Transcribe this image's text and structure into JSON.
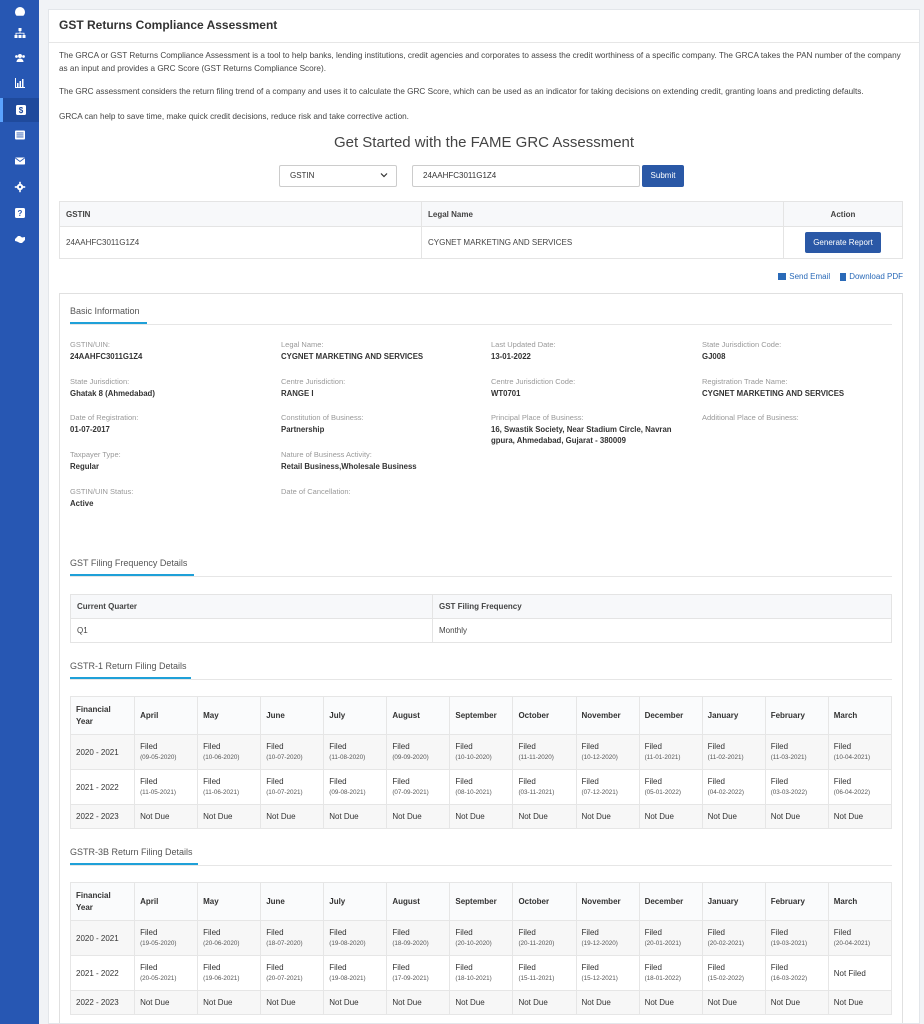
{
  "sidebar": {
    "items": [
      "dashboard-icon",
      "sitemap-icon",
      "users-icon",
      "chart-icon",
      "dollar-icon",
      "list-icon",
      "mail-icon",
      "gear-icon",
      "help-icon",
      "handshake-icon"
    ]
  },
  "page": {
    "title": "GST Returns Compliance Assessment",
    "p1": "The GRCA or GST Returns Compliance Assessment is a tool to help banks, lending institutions, credit agencies and corporates to assess the credit worthiness of a specific company. The GRCA takes the PAN number of the company as an input and provides a GRC Score (GST Returns Compliance Score).",
    "p2": "The GRC assessment considers the return filing trend of a company and uses it to calculate the GRC Score, which can be used as an indicator for taking decisions on extending credit, granting loans and predicting defaults.",
    "p3": "GRCA can help to save time, make quick credit decisions, reduce risk and take corrective action.",
    "get_started": "Get Started with the FAME GRC Assessment"
  },
  "search": {
    "select_value": "GSTIN",
    "input_value": "24AAHFC3011G1Z4",
    "submit_label": "Submit"
  },
  "gstin_table": {
    "headers": [
      "GSTIN",
      "Legal Name",
      "Action"
    ],
    "gstin": "24AAHFC3011G1Z4",
    "legal_name": "CYGNET MARKETING AND SERVICES",
    "action_label": "Generate Report"
  },
  "links": {
    "send_email": "Send Email",
    "download_pdf": "Download PDF"
  },
  "basic": {
    "heading": "Basic Information",
    "fields": [
      {
        "label": "GSTIN/UIN:",
        "value": "24AAHFC3011G1Z4"
      },
      {
        "label": "Legal Name:",
        "value": "CYGNET MARKETING AND SERVICES"
      },
      {
        "label": "Last Updated Date:",
        "value": "13-01-2022"
      },
      {
        "label": "State Jurisdiction Code:",
        "value": "GJ008"
      },
      {
        "label": "State Jurisdiction:",
        "value": "Ghatak 8 (Ahmedabad)"
      },
      {
        "label": "Centre Jurisdiction:",
        "value": "RANGE I"
      },
      {
        "label": "Centre Jurisdiction Code:",
        "value": "WT0701"
      },
      {
        "label": "Registration Trade Name:",
        "value": "CYGNET MARKETING AND SERVICES"
      },
      {
        "label": "Date of Registration:",
        "value": "01-07-2017"
      },
      {
        "label": "Constitution of Business:",
        "value": "Partnership"
      },
      {
        "label": "Principal Place of Business:",
        "value": "16, Swastik Society, Near Stadium Circle, Navran gpura, Ahmedabad, Gujarat - 380009"
      },
      {
        "label": "Additional Place of Business:",
        "value": ""
      },
      {
        "label": "Taxpayer Type:",
        "value": "Regular"
      },
      {
        "label": "Nature of Business Activity:",
        "value": "Retail Business,Wholesale Business"
      },
      {
        "label": "GSTIN/UIN Status:",
        "value": "Active"
      },
      {
        "label": "Date of Cancellation:",
        "value": ""
      }
    ]
  },
  "freq": {
    "heading": "GST Filing Frequency Details",
    "headers": [
      "Current Quarter",
      "GST Filing Frequency"
    ],
    "row": [
      "Q1",
      "Monthly"
    ]
  },
  "gstr1": {
    "heading": "GSTR-1 Return Filing Details",
    "headers": [
      "Financial Year",
      "April",
      "May",
      "June",
      "July",
      "August",
      "September",
      "October",
      "November",
      "December",
      "January",
      "February",
      "March"
    ],
    "rows": [
      {
        "year": "2020 - 2021",
        "cells": [
          [
            "Filed",
            "(09-05-2020)"
          ],
          [
            "Filed",
            "(10-06-2020)"
          ],
          [
            "Filed",
            "(10-07-2020)"
          ],
          [
            "Filed",
            "(11-08-2020)"
          ],
          [
            "Filed",
            "(09-09-2020)"
          ],
          [
            "Filed",
            "(10-10-2020)"
          ],
          [
            "Filed",
            "(11-11-2020)"
          ],
          [
            "Filed",
            "(10-12-2020)"
          ],
          [
            "Filed",
            "(11-01-2021)"
          ],
          [
            "Filed",
            "(11-02-2021)"
          ],
          [
            "Filed",
            "(11-03-2021)"
          ],
          [
            "Filed",
            "(10-04-2021)"
          ]
        ]
      },
      {
        "year": "2021 - 2022",
        "cells": [
          [
            "Filed",
            "(11-05-2021)"
          ],
          [
            "Filed",
            "(11-06-2021)"
          ],
          [
            "Filed",
            "(10-07-2021)"
          ],
          [
            "Filed",
            "(09-08-2021)"
          ],
          [
            "Filed",
            "(07-09-2021)"
          ],
          [
            "Filed",
            "(08-10-2021)"
          ],
          [
            "Filed",
            "(03-11-2021)"
          ],
          [
            "Filed",
            "(07-12-2021)"
          ],
          [
            "Filed",
            "(05-01-2022)"
          ],
          [
            "Filed",
            "(04-02-2022)"
          ],
          [
            "Filed",
            "(03-03-2022)"
          ],
          [
            "Filed",
            "(06-04-2022)"
          ]
        ]
      },
      {
        "year": "2022 - 2023",
        "cells": [
          [
            "Not Due",
            ""
          ],
          [
            "Not Due",
            ""
          ],
          [
            "Not Due",
            ""
          ],
          [
            "Not Due",
            ""
          ],
          [
            "Not Due",
            ""
          ],
          [
            "Not Due",
            ""
          ],
          [
            "Not Due",
            ""
          ],
          [
            "Not Due",
            ""
          ],
          [
            "Not Due",
            ""
          ],
          [
            "Not Due",
            ""
          ],
          [
            "Not Due",
            ""
          ],
          [
            "Not Due",
            ""
          ]
        ]
      }
    ]
  },
  "gstr3b": {
    "heading": "GSTR-3B Return Filing Details",
    "headers": [
      "Financial Year",
      "April",
      "May",
      "June",
      "July",
      "August",
      "September",
      "October",
      "November",
      "December",
      "January",
      "February",
      "March"
    ],
    "rows": [
      {
        "year": "2020 - 2021",
        "cells": [
          [
            "Filed",
            "(19-05-2020)"
          ],
          [
            "Filed",
            "(20-06-2020)"
          ],
          [
            "Filed",
            "(18-07-2020)"
          ],
          [
            "Filed",
            "(19-08-2020)"
          ],
          [
            "Filed",
            "(18-09-2020)"
          ],
          [
            "Filed",
            "(20-10-2020)"
          ],
          [
            "Filed",
            "(20-11-2020)"
          ],
          [
            "Filed",
            "(19-12-2020)"
          ],
          [
            "Filed",
            "(20-01-2021)"
          ],
          [
            "Filed",
            "(20-02-2021)"
          ],
          [
            "Filed",
            "(19-03-2021)"
          ],
          [
            "Filed",
            "(20-04-2021)"
          ]
        ]
      },
      {
        "year": "2021 - 2022",
        "cells": [
          [
            "Filed",
            "(20-05-2021)"
          ],
          [
            "Filed",
            "(19-06-2021)"
          ],
          [
            "Filed",
            "(20-07-2021)"
          ],
          [
            "Filed",
            "(19-08-2021)"
          ],
          [
            "Filed",
            "(17-09-2021)"
          ],
          [
            "Filed",
            "(18-10-2021)"
          ],
          [
            "Filed",
            "(15-11-2021)"
          ],
          [
            "Filed",
            "(15-12-2021)"
          ],
          [
            "Filed",
            "(18-01-2022)"
          ],
          [
            "Filed",
            "(15-02-2022)"
          ],
          [
            "Filed",
            "(16-03-2022)"
          ],
          [
            "Not Filed",
            ""
          ]
        ]
      },
      {
        "year": "2022 - 2023",
        "cells": [
          [
            "Not Due",
            ""
          ],
          [
            "Not Due",
            ""
          ],
          [
            "Not Due",
            ""
          ],
          [
            "Not Due",
            ""
          ],
          [
            "Not Due",
            ""
          ],
          [
            "Not Due",
            ""
          ],
          [
            "Not Due",
            ""
          ],
          [
            "Not Due",
            ""
          ],
          [
            "Not Due",
            ""
          ],
          [
            "Not Due",
            ""
          ],
          [
            "Not Due",
            ""
          ],
          [
            "Not Due",
            ""
          ]
        ]
      }
    ]
  }
}
